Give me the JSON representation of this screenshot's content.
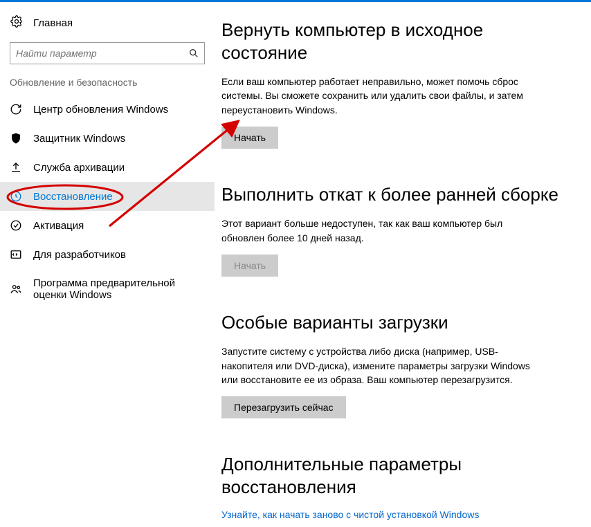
{
  "home_label": "Главная",
  "search": {
    "placeholder": "Найти параметр"
  },
  "section_header": "Обновление и безопасность",
  "nav": {
    "items": [
      {
        "label": "Центр обновления Windows"
      },
      {
        "label": "Защитник Windows"
      },
      {
        "label": "Служба архивации"
      },
      {
        "label": "Восстановление"
      },
      {
        "label": "Активация"
      },
      {
        "label": "Для разработчиков"
      },
      {
        "label": "Программа предварительной оценки Windows"
      }
    ]
  },
  "content": {
    "reset": {
      "title": "Вернуть компьютер в исходное состояние",
      "body": "Если ваш компьютер работает неправильно, может помочь сброс системы. Вы сможете сохранить или удалить свои файлы, и затем переустановить Windows.",
      "button": "Начать"
    },
    "rollback": {
      "title": "Выполнить откат к более ранней сборке",
      "body": "Этот вариант больше недоступен, так как ваш компьютер был обновлен более 10 дней назад.",
      "button": "Начать"
    },
    "advanced": {
      "title": "Особые варианты загрузки",
      "body": "Запустите систему с устройства либо диска (например, USB-накопителя или DVD-диска), измените параметры загрузки Windows или восстановите ее из образа. Ваш компьютер перезагрузится.",
      "button": "Перезагрузить сейчас"
    },
    "more": {
      "title": "Дополнительные параметры восстановления",
      "link": "Узнайте, как начать заново с чистой установкой Windows"
    }
  }
}
